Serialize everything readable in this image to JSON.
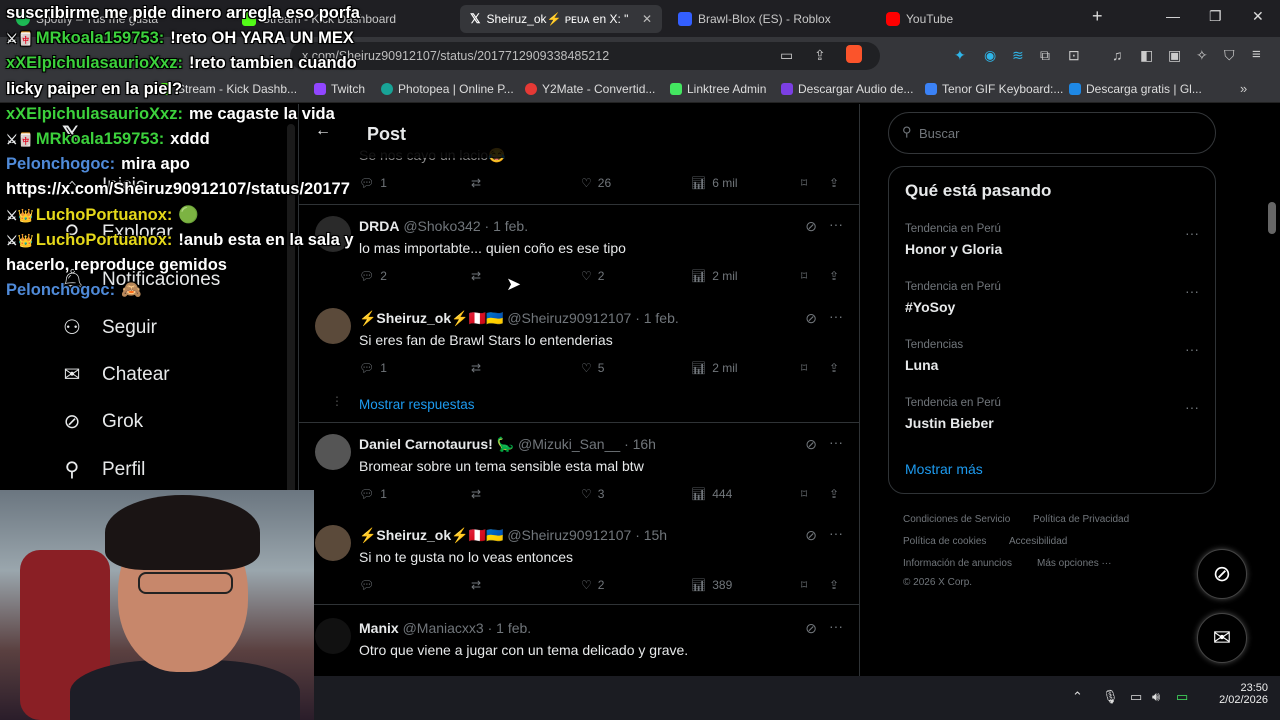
{
  "browser": {
    "tabs": [
      {
        "label": "Spotify – Tus me gusta",
        "color": "#1db954"
      },
      {
        "label": "Stream - Kick Dashboard",
        "color": "#53fc18"
      },
      {
        "label": "Sheiruz_ok⚡ ᴘᴇᴜᴀ en X: \"",
        "color": "#ffffff"
      },
      {
        "label": "Brawl-Blox (ES) - Roblox",
        "color": "#335fff"
      },
      {
        "label": "YouTube",
        "color": "#ff0000"
      }
    ],
    "url": "x.com/Sheiruz90912107/status/2017712909338485212",
    "bookmarks": [
      {
        "label": "Stream - Kick Dashb...",
        "color": "#53fc18"
      },
      {
        "label": "Twitch",
        "color": "#9146ff"
      },
      {
        "label": "Photopea | Online P...",
        "color": "#18a497"
      },
      {
        "label": "Y2Mate - Convertid...",
        "color": "#e53935"
      },
      {
        "label": "Linktree Admin",
        "color": "#43e660"
      },
      {
        "label": "Descargar Audio de...",
        "color": "#7b3fe4"
      },
      {
        "label": "Tenor GIF Keyboard:...",
        "color": "#3b82f6"
      },
      {
        "label": "Descarga gratis | Gl...",
        "color": "#1e88e5"
      }
    ]
  },
  "sidebar": {
    "items": [
      {
        "label": "Inicio",
        "icon": "home-icon"
      },
      {
        "label": "Explorar",
        "icon": "search-icon"
      },
      {
        "label": "Notificaciones",
        "icon": "bell-icon"
      },
      {
        "label": "Seguir",
        "icon": "follow-icon"
      },
      {
        "label": "Chatear",
        "icon": "mail-icon"
      },
      {
        "label": "Grok",
        "icon": "grok-icon"
      },
      {
        "label": "Perfil",
        "icon": "person-icon"
      }
    ]
  },
  "timeline": {
    "title": "Post",
    "partial_text": "Se nos cayo un lacio😂",
    "partial_stats": {
      "replies": "1",
      "likes": "26",
      "views": "6 mil"
    },
    "posts": [
      {
        "name": "DRDA",
        "handle": "@Shoko342",
        "time": "· 1 feb.",
        "text": "lo mas importabte... quien coño es ese tipo",
        "replies": "2",
        "likes": "2",
        "views": "2 mil"
      },
      {
        "name": "⚡Sheiruz_ok⚡🇵🇪🇺🇦",
        "handle": "@Sheiruz90912107",
        "time": "· 1 feb.",
        "text": "Si eres fan de Brawl Stars lo entenderias",
        "replies": "1",
        "likes": "5",
        "views": "2 mil"
      },
      {
        "name": "Daniel Carnotaurus! 🦕",
        "handle": "@Mizuki_San__",
        "time": "· 16h",
        "text": "Bromear sobre un tema sensible esta mal btw",
        "replies": "1",
        "likes": "3",
        "views": "444"
      },
      {
        "name": "⚡Sheiruz_ok⚡🇵🇪🇺🇦",
        "handle": "@Sheiruz90912107",
        "time": "· 15h",
        "text": "Si no te gusta no lo veas entonces",
        "replies": "",
        "likes": "2",
        "views": "389"
      },
      {
        "name": "Manix",
        "handle": "@Maniacxx3",
        "time": "· 1 feb.",
        "text": "Otro que viene a jugar con un tema delicado y grave.",
        "replies": "",
        "likes": "",
        "views": ""
      }
    ],
    "show_replies": "Mostrar respuestas"
  },
  "right": {
    "search_placeholder": "Buscar",
    "trends_title": "Qué está pasando",
    "trends": [
      {
        "category": "Tendencia en Perú",
        "name": "Honor y Gloria"
      },
      {
        "category": "Tendencia en Perú",
        "name": "#YoSoy"
      },
      {
        "category": "Tendencias",
        "name": "Luna"
      },
      {
        "category": "Tendencia en Perú",
        "name": "Justin Bieber"
      }
    ],
    "show_more": "Mostrar más",
    "footer": [
      "Condiciones de Servicio",
      "Política de Privacidad",
      "Política de cookies",
      "Accesibilidad",
      "Información de anuncios",
      "Más opciones ···",
      "© 2026 X Corp."
    ]
  },
  "taskbar": {
    "time": "23:50",
    "date": "2/02/2026"
  },
  "chat": [
    {
      "user": "",
      "msg": "suscribirme me pide dinero arregla eso porfa",
      "color": "#ffffff"
    },
    {
      "user": "MRkoala159753:",
      "msg": "!reto OH YARA UN MEX",
      "color": "#3cd13c",
      "badge": "⚔🀄"
    },
    {
      "user": "xXElpichulasaurioXxz:",
      "msg": "!reto tambien cuando",
      "color": "#3cd13c",
      "badge": ""
    },
    {
      "user": "",
      "msg": "licky paiper en la piel?",
      "color": "#ffffff"
    },
    {
      "user": "xXElpichulasaurioXxz:",
      "msg": "me cagaste la vida",
      "color": "#3cd13c",
      "badge": ""
    },
    {
      "user": "MRkoala159753:",
      "msg": "xddd",
      "color": "#3cd13c",
      "badge": "⚔🀄"
    },
    {
      "user": "Pelonchogoc:",
      "msg": "mira apo",
      "color": "#4f8ad8",
      "badge": ""
    },
    {
      "user": "",
      "msg": "https://x.com/Sheiruz90912107/status/20177",
      "color": "#ffffff"
    },
    {
      "user": "LuchoPortuanox:",
      "msg": "🟢",
      "color": "#e5d81a",
      "badge": "⚔👑"
    },
    {
      "user": "LuchoPortuanox:",
      "msg": "!anub esta en la sala y",
      "color": "#e5d81a",
      "badge": "⚔👑"
    },
    {
      "user": "",
      "msg": "hacerlo, reproduce gemidos",
      "color": "#ffffff"
    },
    {
      "user": "Pelonchogoc:",
      "msg": "🙈",
      "color": "#4f8ad8",
      "badge": ""
    }
  ]
}
